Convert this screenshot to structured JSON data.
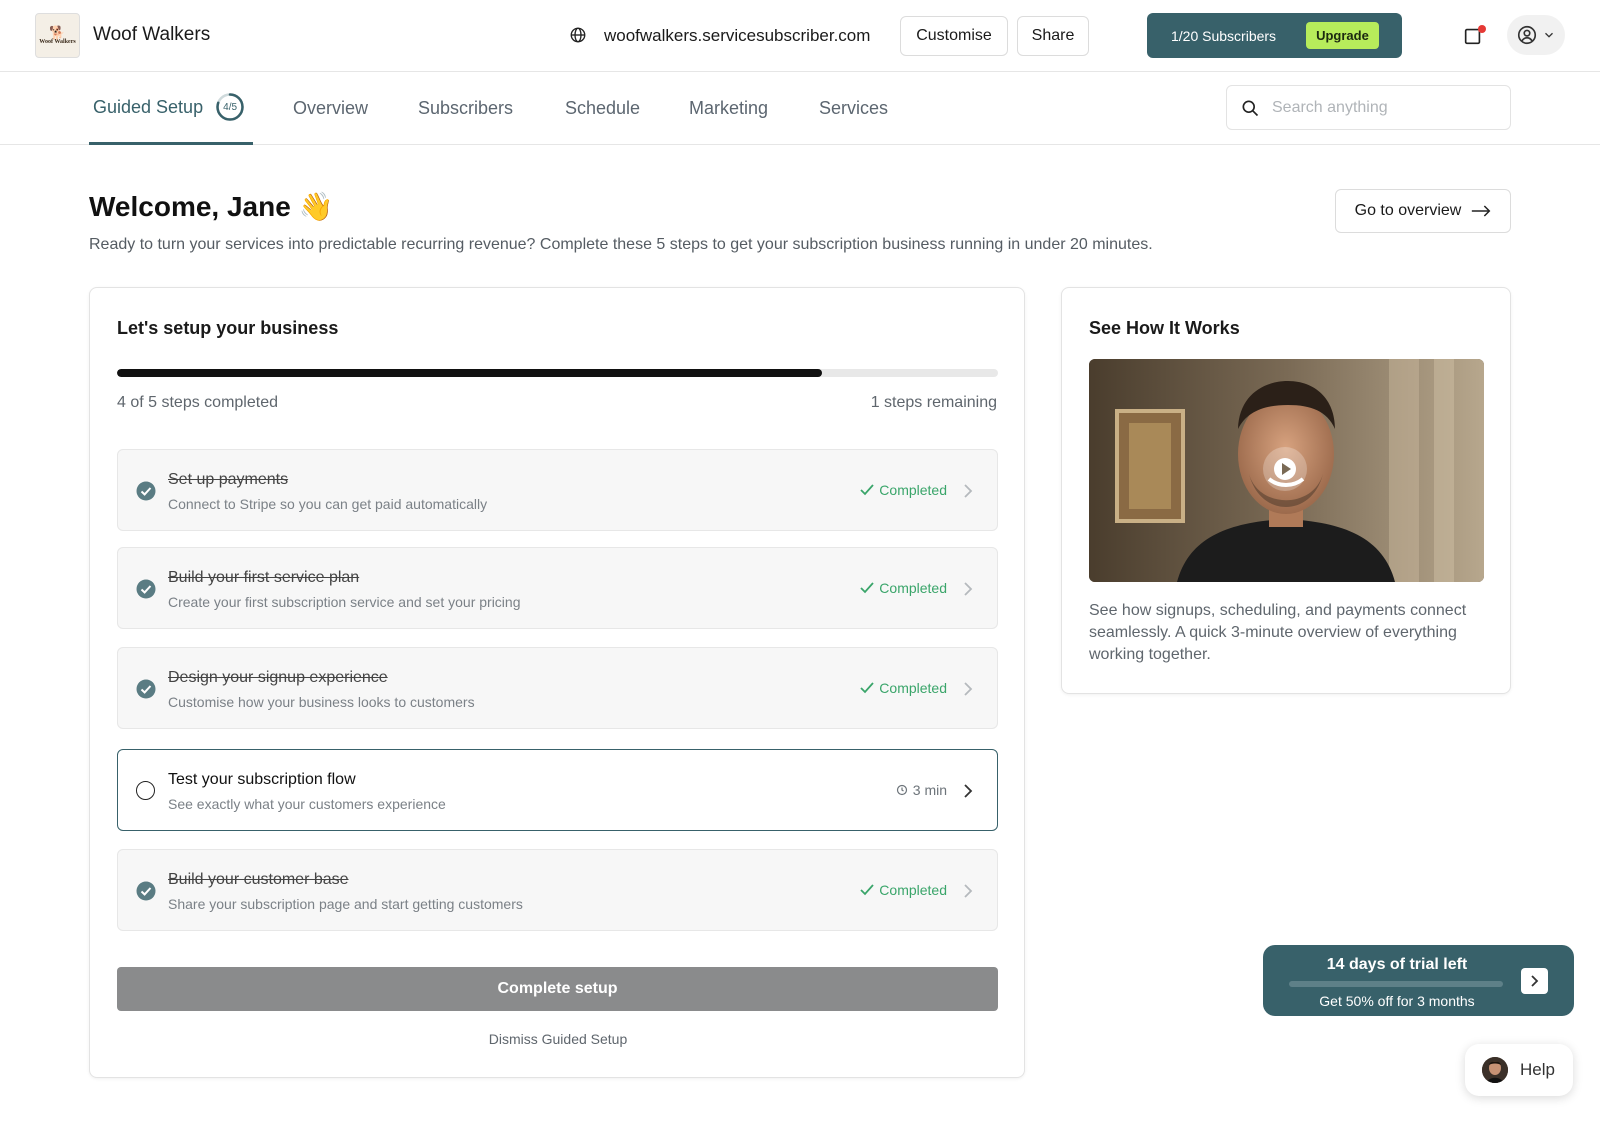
{
  "app": {
    "name": "Woof Walkers",
    "logo_text": "Woof Walkers",
    "domain": "woofwalkers.servicesubscriber.com"
  },
  "header": {
    "customise_label": "Customise",
    "share_label": "Share",
    "subscribers_count": "1/20 Subscribers",
    "upgrade_label": "Upgrade",
    "icons": [
      "globe-icon",
      "notification-icon",
      "user-icon",
      "chevron-down-icon"
    ]
  },
  "nav": {
    "tabs": [
      {
        "label": "Guided Setup",
        "badge": "4/5",
        "active": true
      },
      {
        "label": "Overview",
        "active": false
      },
      {
        "label": "Subscribers",
        "active": false
      },
      {
        "label": "Schedule",
        "active": false
      },
      {
        "label": "Marketing",
        "active": false
      },
      {
        "label": "Services",
        "active": false
      }
    ],
    "search_placeholder": "Search anything"
  },
  "welcome": {
    "title": "Welcome, Jane 👋",
    "intro": "Ready to turn your services into predictable recurring revenue? Complete these 5 steps to get your subscription business running in under 20 minutes.",
    "go_overview_label": "Go to overview"
  },
  "setup": {
    "title": "Let's setup your business",
    "progress": 0.8,
    "completed_text": "4 of 5 steps completed",
    "remaining_text": "1 steps remaining",
    "steps": [
      {
        "title": "Set up payments",
        "description": "Connect to Stripe so you can get paid automatically",
        "status": "Completed",
        "done": true
      },
      {
        "title": "Build your first service plan",
        "description": "Create your first subscription service and set your pricing",
        "status": "Completed",
        "done": true
      },
      {
        "title": "Design your signup experience",
        "description": "Customise how your business looks to customers",
        "status": "Completed",
        "done": true
      },
      {
        "title": "Test your subscription flow",
        "description": "See exactly what your customers experience",
        "status": "3 min",
        "done": false
      },
      {
        "title": "Build your customer base",
        "description": "Share your subscription page and start getting customers",
        "status": "Completed",
        "done": true
      }
    ],
    "complete_label": "Complete setup",
    "dismiss_label": "Dismiss Guided Setup"
  },
  "how_it_works": {
    "title": "See How It Works",
    "description": "See how signups, scheduling, and payments connect seamlessly. A quick 3-minute overview of everything working together."
  },
  "trial": {
    "title": "14 days of trial left",
    "offer": "Get 50% off for 3 months",
    "progress": 0.0
  },
  "help": {
    "label": "Help"
  },
  "colors": {
    "accent": "#38616a",
    "upgrade": "#b7ec5b",
    "success": "#3aa56a",
    "notification": "#e53935"
  }
}
